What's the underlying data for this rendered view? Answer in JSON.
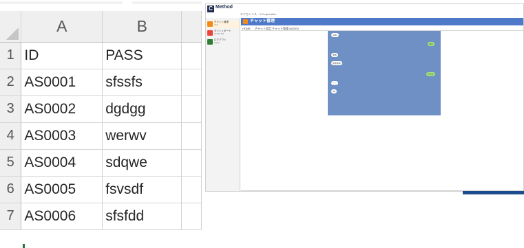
{
  "spreadsheet": {
    "columns": [
      "A",
      "B"
    ],
    "rows": [
      {
        "num": "1",
        "a": "ID",
        "b": "PASS"
      },
      {
        "num": "2",
        "a": "AS0001",
        "b": "sfssfs"
      },
      {
        "num": "3",
        "a": "AS0002",
        "b": "dgdgg"
      },
      {
        "num": "4",
        "a": "AS0003",
        "b": "werwv"
      },
      {
        "num": "5",
        "a": "AS0004",
        "b": "sdqwe"
      },
      {
        "num": "6",
        "a": "AS0005",
        "b": "fsvsdf"
      },
      {
        "num": "7",
        "a": "AS0006",
        "b": "sfsfdd"
      }
    ]
  },
  "app": {
    "logo_letter": "C",
    "logo_text": "Method",
    "breadcrumb": "エクセレンス・A Corporation",
    "sidebar": [
      {
        "label": "チャット管理",
        "sub": "chat",
        "color": "#f08a1c",
        "active": true
      },
      {
        "label": "ダッシュボード",
        "sub": "dashboard",
        "color": "#e8453c",
        "active": false
      },
      {
        "label": "ログアウト",
        "sub": "logout",
        "color": "#2e7d32",
        "active": false
      }
    ],
    "page_title": "チャット管理",
    "tabs": [
      "HOME",
      "チャット設定",
      "チャット管理",
      "ADDED"
    ],
    "chat_bubbles": [
      {
        "text": "Hello",
        "side": "left"
      },
      {
        "text": "はい",
        "side": "right"
      },
      {
        "text": "ああ",
        "side": "left"
      },
      {
        "text": "ああああ",
        "side": "left"
      },
      {
        "text": "テスト",
        "side": "right"
      },
      {
        "text": "ここ",
        "side": "left"
      },
      {
        "text": "OK",
        "side": "left"
      }
    ]
  }
}
